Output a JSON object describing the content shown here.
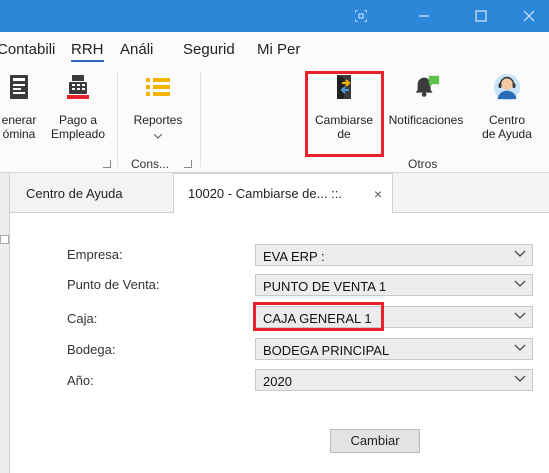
{
  "menu": {
    "tabs": [
      "Contabili",
      "RRH",
      "Análi",
      "Segurid",
      "Mi Per"
    ],
    "active": "RRH"
  },
  "ribbon": {
    "buttons": [
      {
        "label_line1": "enerar",
        "label_line2": "ómina",
        "icon": "receipt-icon"
      },
      {
        "label_line1": "Pago a",
        "label_line2": "Empleado",
        "icon": "cash-register-icon"
      },
      {
        "label_line1": "Reportes",
        "label_line2": "",
        "icon": "list-icon"
      },
      {
        "label_line1": "Cambiarse",
        "label_line2": "de",
        "icon": "switch-exchange-icon"
      },
      {
        "label_line1": "Notificaciones",
        "label_line2": "",
        "icon": "notification-bell-icon"
      },
      {
        "label_line1": "Centro",
        "label_line2": "de Ayuda",
        "icon": "help-agent-icon"
      }
    ],
    "groups": [
      "Cons...",
      "Otros"
    ]
  },
  "doc_tabs": [
    {
      "label": "Centro de Ayuda"
    },
    {
      "label": "10020 - Cambiarse de... ::.",
      "close": "×"
    }
  ],
  "form": {
    "fields": [
      {
        "label": "Empresa:",
        "value": "EVA ERP :"
      },
      {
        "label": "Punto de Venta:",
        "value": "PUNTO DE VENTA 1"
      },
      {
        "label": "Caja:",
        "value": "CAJA GENERAL 1"
      },
      {
        "label": "Bodega:",
        "value": "BODEGA PRINCIPAL"
      },
      {
        "label": "Año:",
        "value": "2020"
      }
    ],
    "submit_label": "Cambiar"
  },
  "colors": {
    "titlebar": "#2b88d8",
    "highlight": "#e8212a",
    "accent": "#2b6cb8"
  }
}
